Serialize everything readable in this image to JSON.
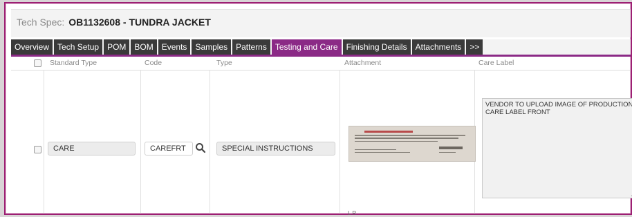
{
  "title": {
    "label": "Tech Spec:",
    "value": "OB1132608 - TUNDRA JACKET"
  },
  "tabs": [
    {
      "label": "Overview"
    },
    {
      "label": "Tech Setup"
    },
    {
      "label": "POM"
    },
    {
      "label": "BOM"
    },
    {
      "label": "Events"
    },
    {
      "label": "Samples"
    },
    {
      "label": "Patterns"
    },
    {
      "label": "Testing and Care",
      "active": true
    },
    {
      "label": "Finishing Details"
    },
    {
      "label": "Attachments"
    },
    {
      "label": ">>"
    }
  ],
  "columns": {
    "standard_type": "Standard Type",
    "code": "Code",
    "type": "Type",
    "attachment": "Attachment",
    "care_label": "Care Label"
  },
  "row": {
    "standard_type": "CARE",
    "code": "CAREFRT",
    "type": "SPECIAL INSTRUCTIONS",
    "attachment_caption": "L R",
    "care_label": "VENDOR TO UPLOAD IMAGE OF PRODUCTION CARE LABEL FRONT"
  },
  "colors": {
    "accent": "#8b2a86",
    "tab_bg": "#3a3a3a",
    "frame": "#9c1f73"
  },
  "icons": {
    "code_lookup": "magnifier-icon"
  }
}
